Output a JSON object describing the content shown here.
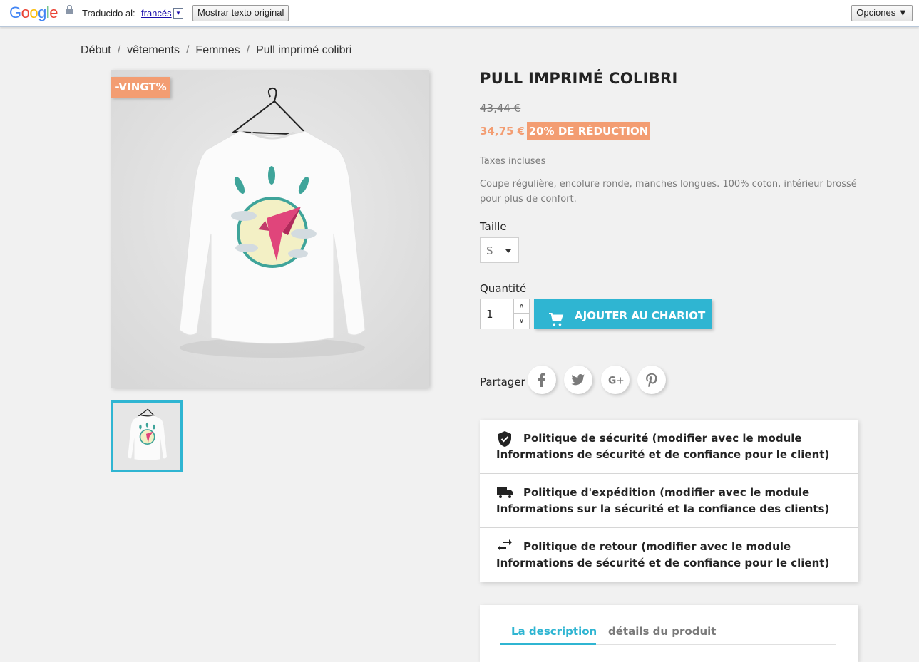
{
  "translate_bar": {
    "logo": {
      "G": "G",
      "o1": "o",
      "o2": "o",
      "g": "g",
      "l": "l",
      "e": "e"
    },
    "translated_label": "Traducido al:",
    "language": "francés",
    "show_original": "Mostrar texto original",
    "options": "Opciones ▼"
  },
  "breadcrumb": [
    "Début",
    "vêtements",
    "Femmes",
    "Pull imprimé colibri"
  ],
  "product": {
    "badge": "-VINGT%",
    "title": "PULL IMPRIMÉ COLIBRI",
    "old_price": "43,44 €",
    "new_price": "34,75 €",
    "discount": "20% DE RÉDUCTION",
    "taxes": "Taxes incluses",
    "description": "Coupe régulière, encolure ronde, manches longues. 100% coton, intérieur brossé pour plus de confort.",
    "size_label": "Taille",
    "size_value": "S",
    "quantity_label": "Quantité",
    "quantity_value": "1",
    "add_to_cart": "AJOUTER AU CHARIOT",
    "share_label": "Partager"
  },
  "reassurance": [
    {
      "icon": "shield-check-icon",
      "text": "Politique de sécurité (modifier avec le module Informations de sécurité et de confiance pour le client)"
    },
    {
      "icon": "truck-icon",
      "text": "Politique d'expédition (modifier avec le module Informations sur la sécurité et la confiance des clients)"
    },
    {
      "icon": "swap-arrows-icon",
      "text": "Politique de retour (modifier avec le module Informations de sécurité et de confiance pour le client)"
    }
  ],
  "tabs": [
    "La description",
    "détails du produit"
  ],
  "colors": {
    "accent": "#2fb5d2",
    "discount": "#f39d72",
    "background": "#f1f1f1"
  }
}
